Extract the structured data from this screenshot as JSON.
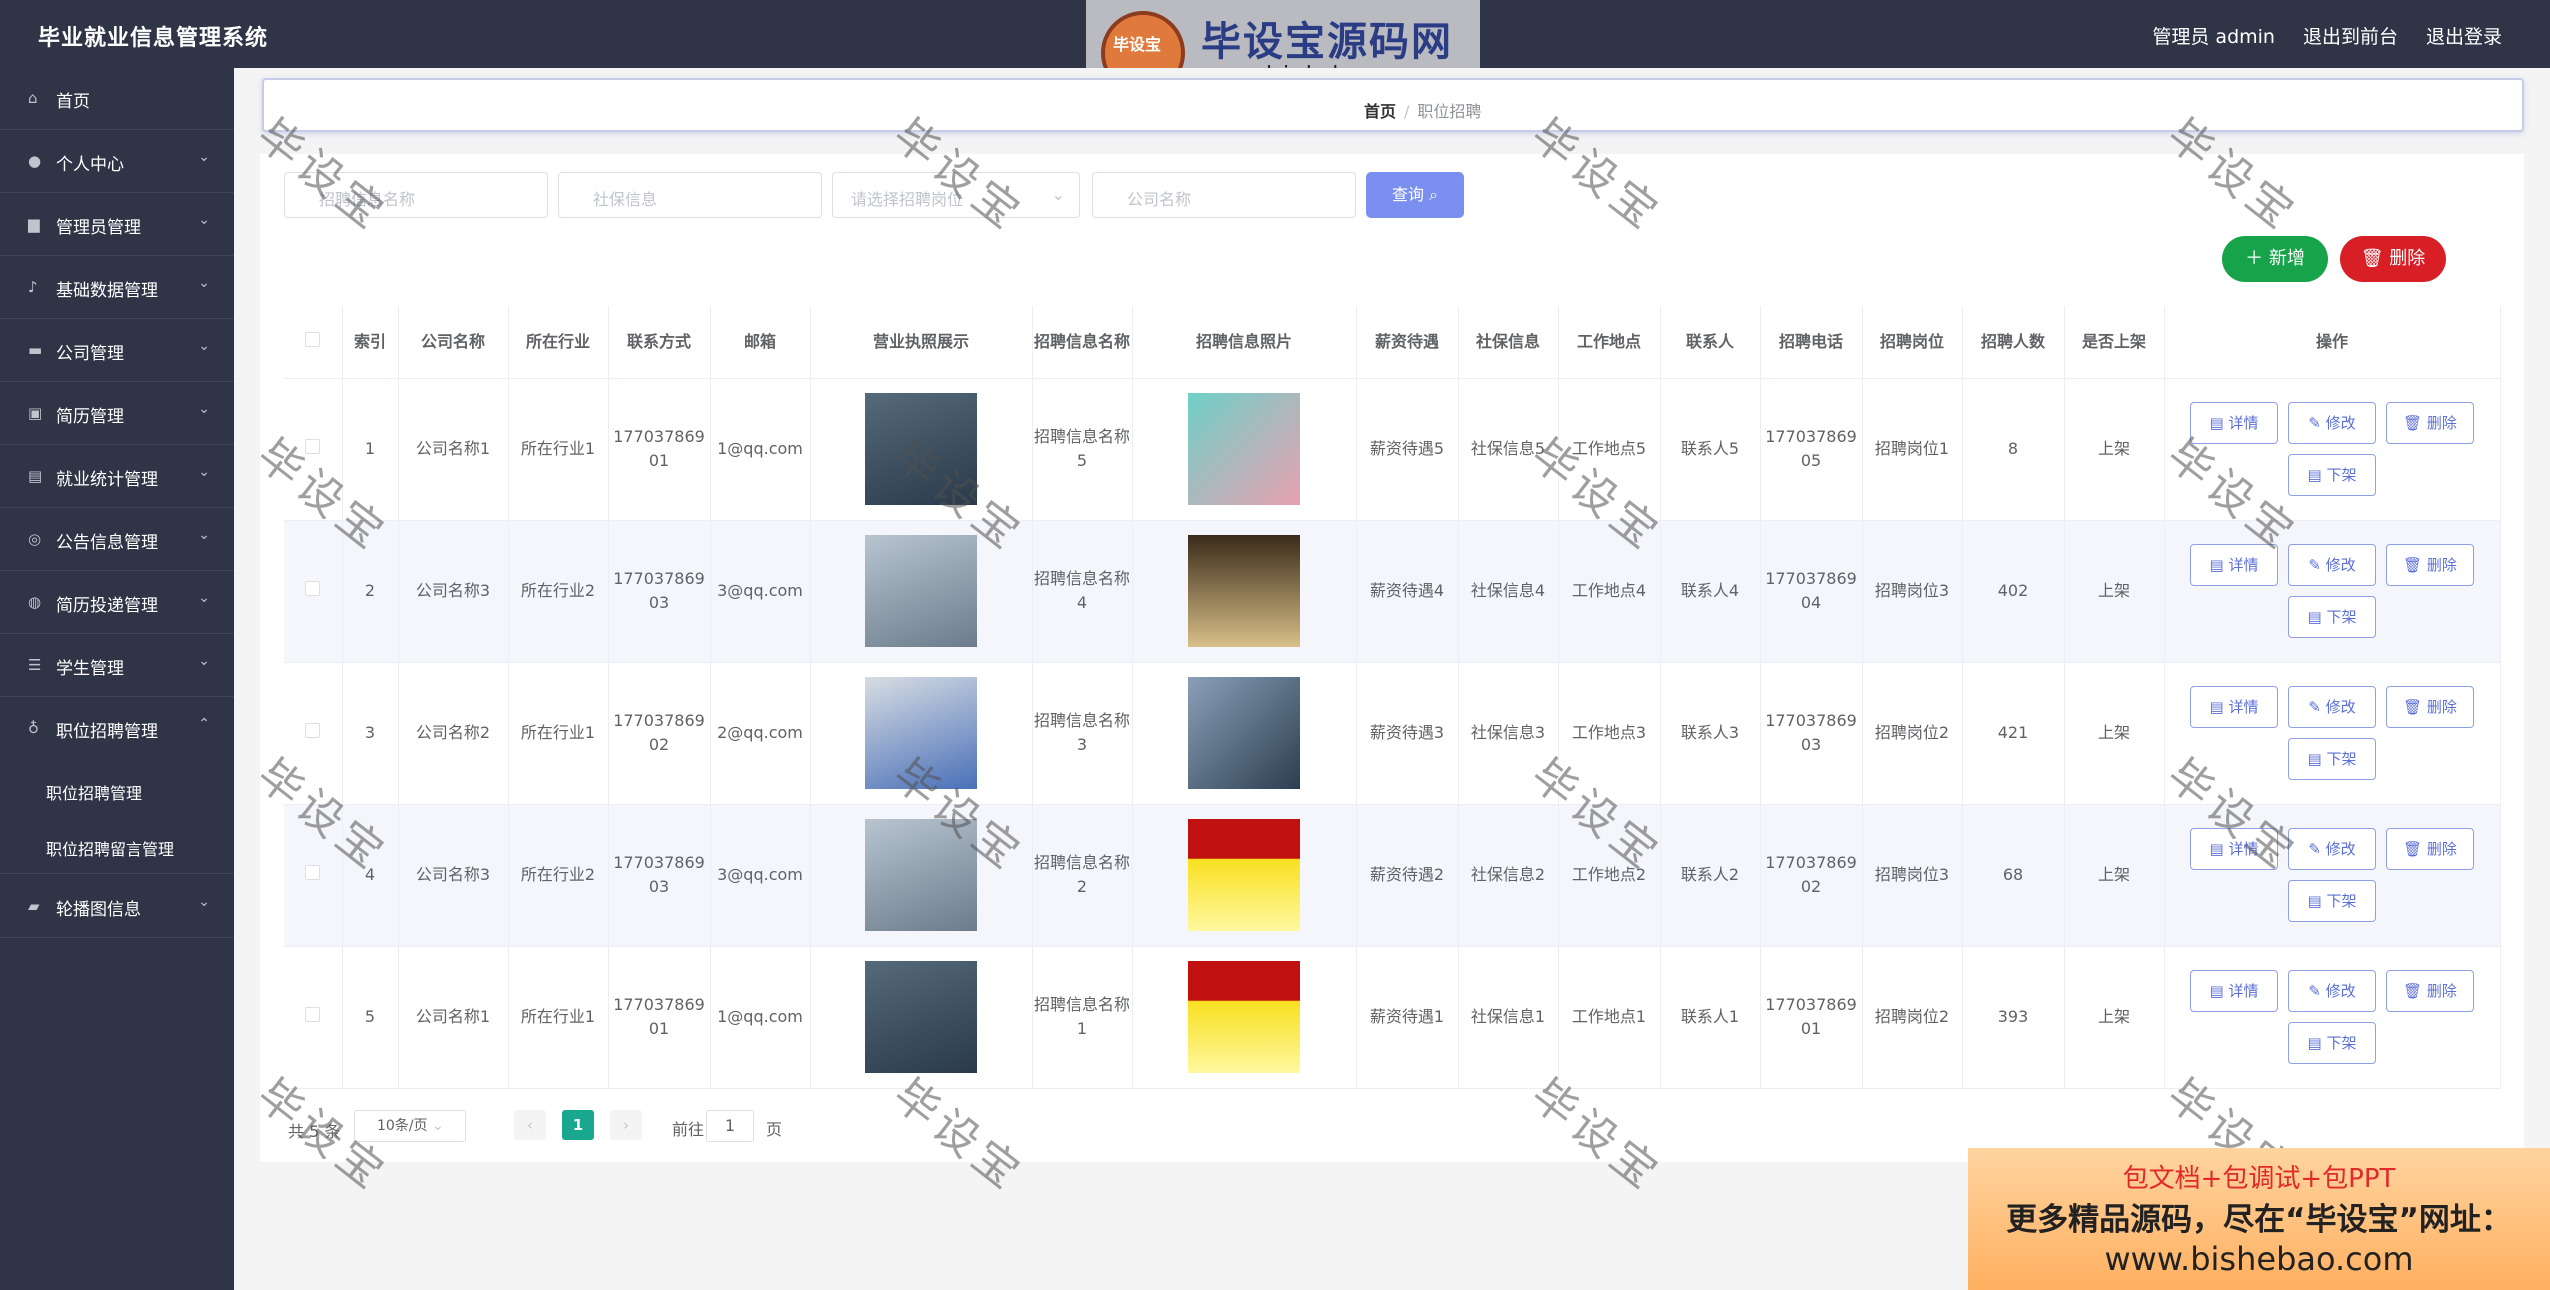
{
  "header": {
    "title": "毕业就业信息管理系统",
    "user": "管理员 admin",
    "back_front": "退出到前台",
    "logout": "退出登录"
  },
  "logo": {
    "badge": "毕设宝",
    "title": "毕设宝源码网",
    "url": "www.bishebao.com"
  },
  "sidebar": {
    "items": [
      {
        "label": "首页",
        "icon": "home-icon"
      },
      {
        "label": "个人中心",
        "icon": "user-icon"
      },
      {
        "label": "管理员管理",
        "icon": "admin-icon"
      },
      {
        "label": "基础数据管理",
        "icon": "bell-icon"
      },
      {
        "label": "公司管理",
        "icon": "monitor-icon"
      },
      {
        "label": "简历管理",
        "icon": "briefcase-icon"
      },
      {
        "label": "就业统计管理",
        "icon": "chart-icon"
      },
      {
        "label": "公告信息管理",
        "icon": "globe-icon"
      },
      {
        "label": "简历投递管理",
        "icon": "compass-icon"
      },
      {
        "label": "学生管理",
        "icon": "menu-icon"
      },
      {
        "label": "职位招聘管理",
        "icon": "bulb-icon"
      },
      {
        "label": "轮播图信息",
        "icon": "image-icon"
      }
    ],
    "sub_items": [
      "职位招聘管理",
      "职位招聘留言管理"
    ]
  },
  "breadcrumb": {
    "home": "首页",
    "sep": "/",
    "current": "职位招聘"
  },
  "search": {
    "name_placeholder": "招聘信息名称",
    "insurance_placeholder": "社保信息",
    "position_placeholder": "请选择招聘岗位",
    "company_placeholder": "公司名称",
    "query_label": "查询"
  },
  "actions": {
    "add_label": "新增",
    "delete_label": "删除"
  },
  "table": {
    "headers": [
      "索引",
      "公司名称",
      "所在行业",
      "联系方式",
      "邮箱",
      "营业执照展示",
      "招聘信息名称",
      "招聘信息照片",
      "薪资待遇",
      "社保信息",
      "工作地点",
      "联系人",
      "招聘电话",
      "招聘岗位",
      "招聘人数",
      "是否上架",
      "操作"
    ],
    "rows": [
      {
        "index": "1",
        "company": "公司名称1",
        "industry": "所在行业1",
        "phone": "17703786901",
        "email": "1@qq.com",
        "name": "招聘信息名称5",
        "salary": "薪资待遇5",
        "insurance": "社保信息5",
        "location": "工作地点5",
        "contact": "联系人5",
        "tel": "17703786905",
        "post": "招聘岗位1",
        "count": "8",
        "status": "上架"
      },
      {
        "index": "2",
        "company": "公司名称3",
        "industry": "所在行业2",
        "phone": "17703786903",
        "email": "3@qq.com",
        "name": "招聘信息名称4",
        "salary": "薪资待遇4",
        "insurance": "社保信息4",
        "location": "工作地点4",
        "contact": "联系人4",
        "tel": "17703786904",
        "post": "招聘岗位3",
        "count": "402",
        "status": "上架"
      },
      {
        "index": "3",
        "company": "公司名称2",
        "industry": "所在行业1",
        "phone": "17703786902",
        "email": "2@qq.com",
        "name": "招聘信息名称3",
        "salary": "薪资待遇3",
        "insurance": "社保信息3",
        "location": "工作地点3",
        "contact": "联系人3",
        "tel": "17703786903",
        "post": "招聘岗位2",
        "count": "421",
        "status": "上架"
      },
      {
        "index": "4",
        "company": "公司名称3",
        "industry": "所在行业2",
        "phone": "17703786903",
        "email": "3@qq.com",
        "name": "招聘信息名称2",
        "salary": "薪资待遇2",
        "insurance": "社保信息2",
        "location": "工作地点2",
        "contact": "联系人2",
        "tel": "17703786902",
        "post": "招聘岗位3",
        "count": "68",
        "status": "上架"
      },
      {
        "index": "5",
        "company": "公司名称1",
        "industry": "所在行业1",
        "phone": "17703786901",
        "email": "1@qq.com",
        "name": "招聘信息名称1",
        "salary": "薪资待遇1",
        "insurance": "社保信息1",
        "location": "工作地点1",
        "contact": "联系人1",
        "tel": "17703786901",
        "post": "招聘岗位2",
        "count": "393",
        "status": "上架"
      }
    ],
    "op_labels": {
      "detail": "详情",
      "edit": "修改",
      "delete": "删除",
      "offshelf": "下架"
    }
  },
  "pager": {
    "total": "共 5 条",
    "page_size": "10条/页",
    "current": "1",
    "goto": "前往",
    "goto_value": "1",
    "unit": "页",
    "prev": "‹",
    "next": "›"
  },
  "watermark": "毕设宝",
  "promo": {
    "line1": "包文档+包调试+包PPT",
    "line2": "更多精品源码，尽在“毕设宝”网址：",
    "line3": "www.bishebao.com"
  },
  "colors": {
    "sidebar": "#2f3447",
    "query": "#7b8ff0",
    "add": "#16a34a",
    "delete": "#d81f26",
    "page_active": "#19a78f"
  }
}
